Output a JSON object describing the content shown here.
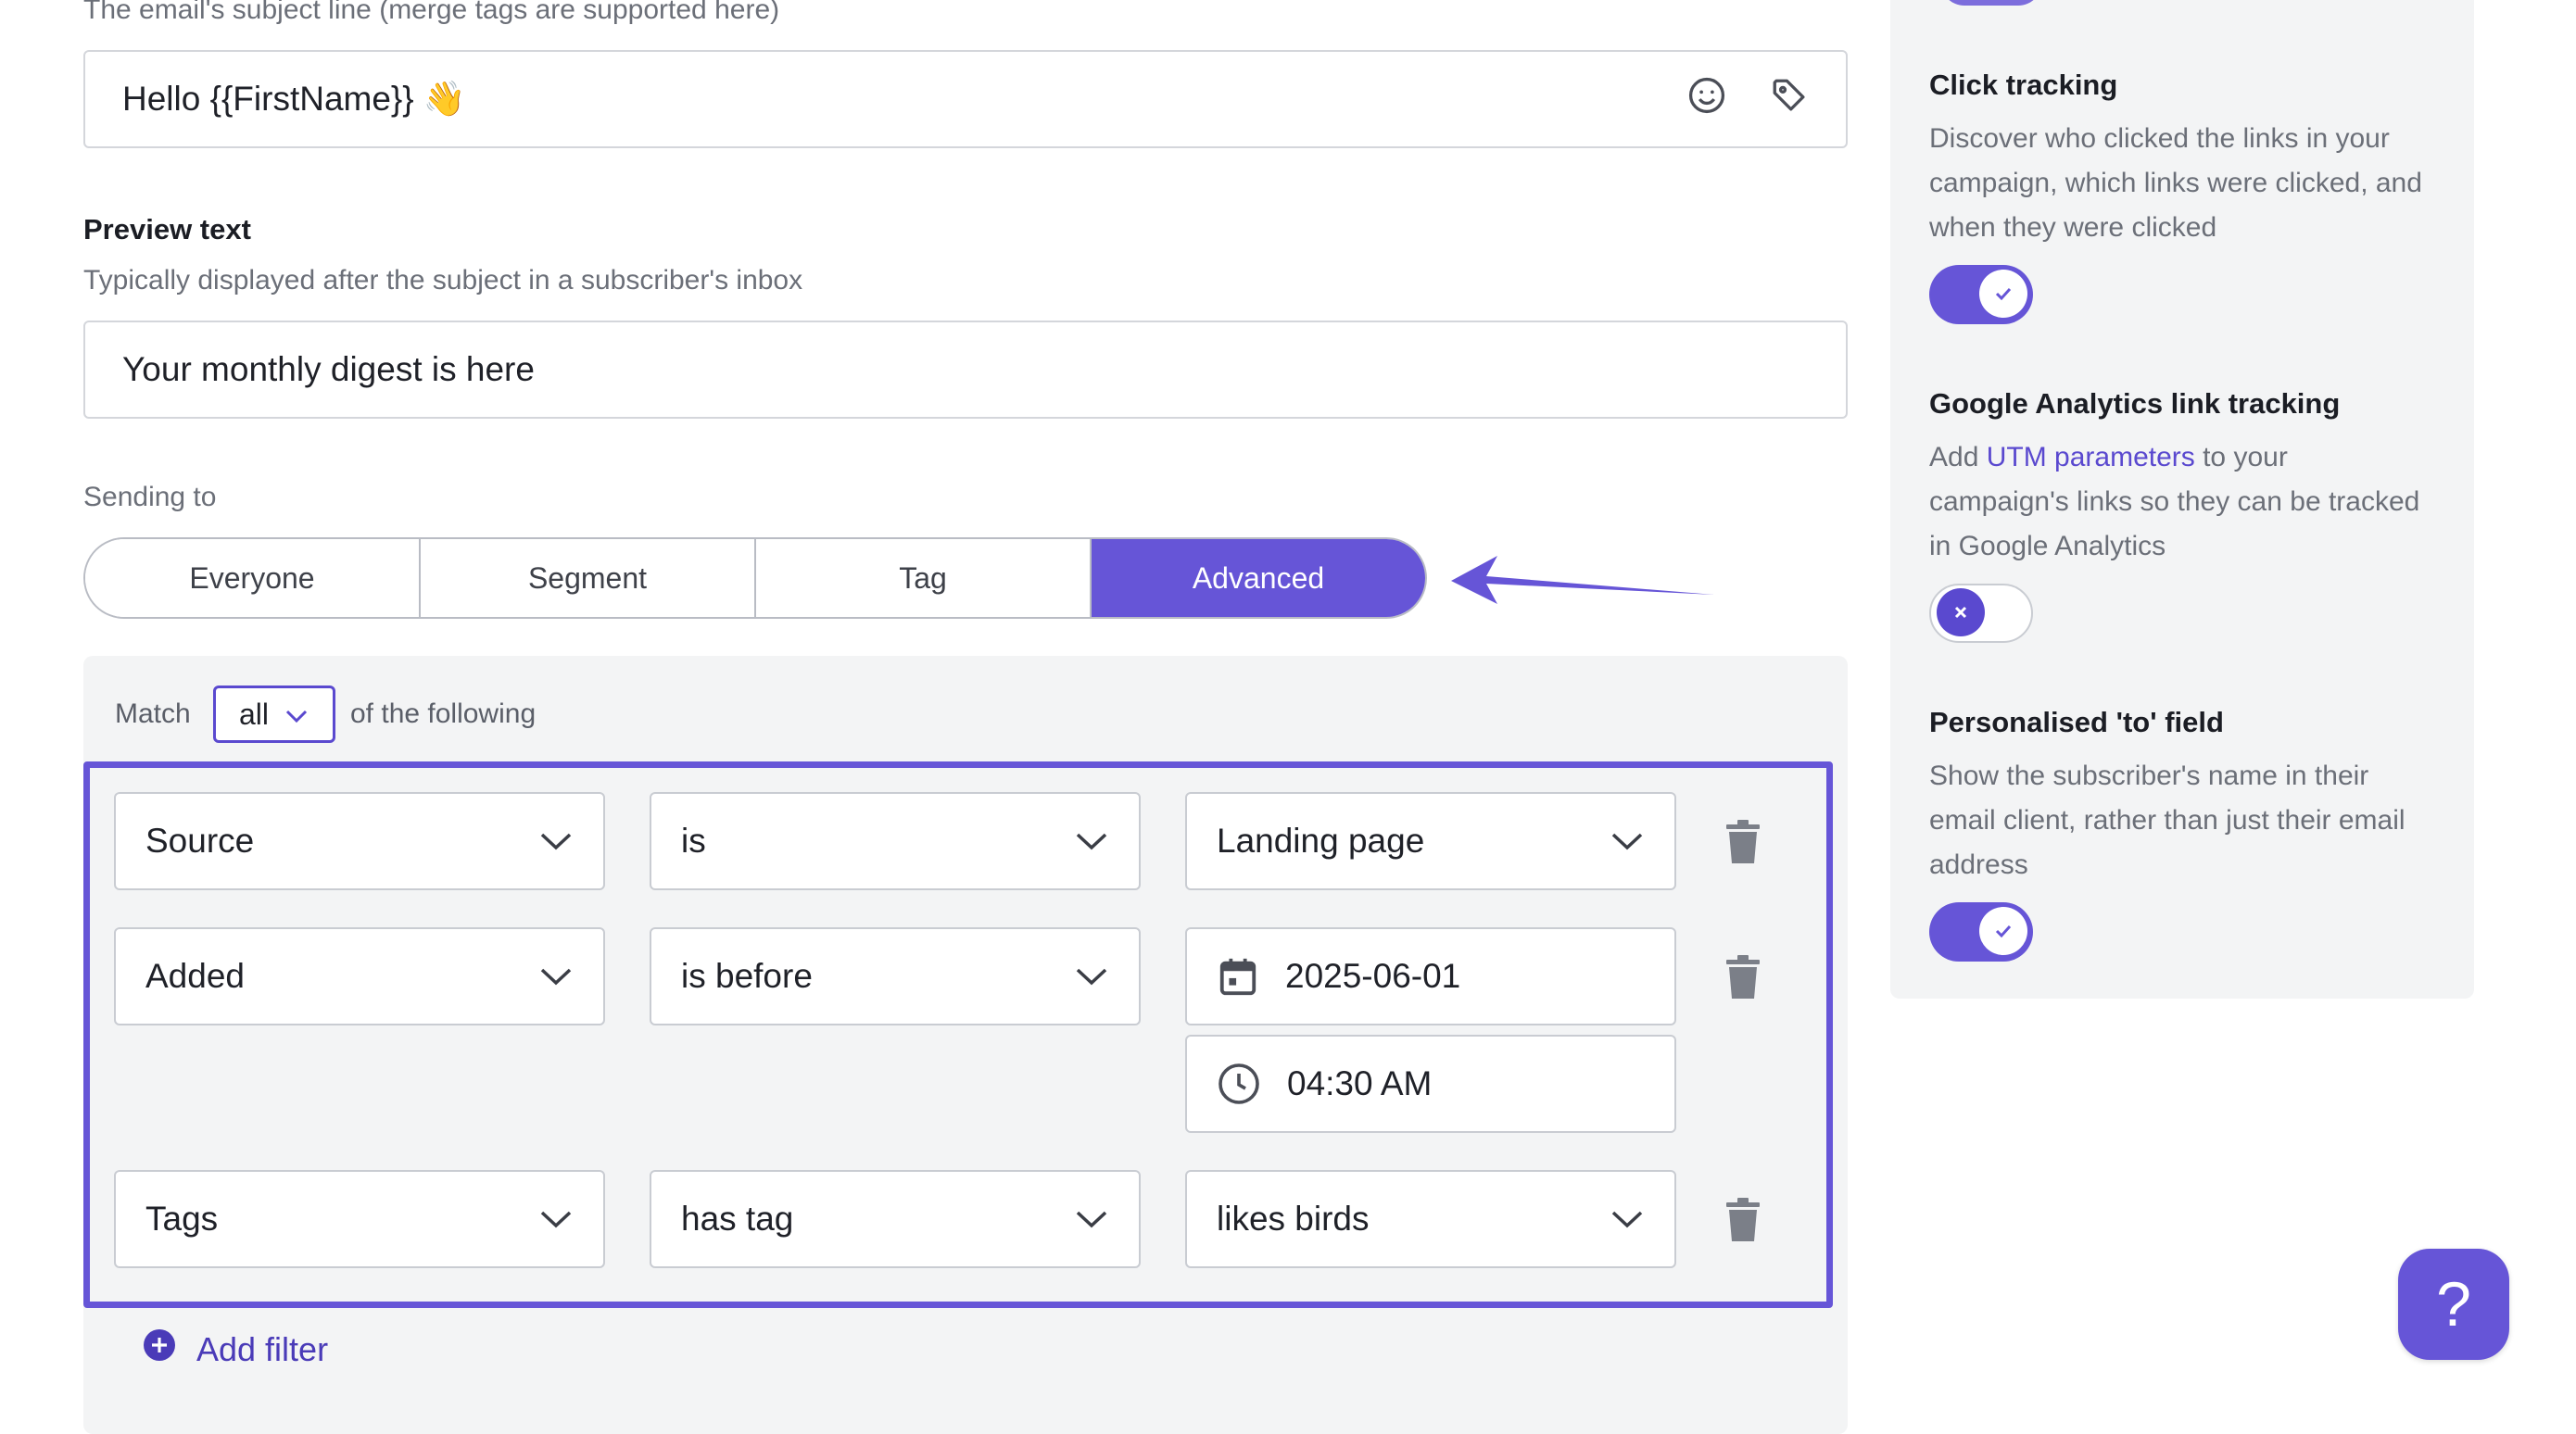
{
  "subject": {
    "hint_prefix": "The email's subject line (merge tags are supported ",
    "hint_link": "here",
    "hint_suffix": ")",
    "value": "Hello {{FirstName}} 👋",
    "emoji_icon": "smiley-icon",
    "tag_icon": "tag-icon"
  },
  "preview": {
    "label": "Preview text",
    "hint": "Typically displayed after the subject in a subscriber's inbox",
    "value": "Your monthly digest is here"
  },
  "sending": {
    "label": "Sending to",
    "options": [
      "Everyone",
      "Segment",
      "Tag",
      "Advanced"
    ],
    "active": "Advanced"
  },
  "filters": {
    "match_prefix": "Match",
    "match_value": "all",
    "match_suffix": "of the following",
    "rows": [
      {
        "field": "Source",
        "operator": "is",
        "value": "Landing page"
      },
      {
        "field": "Added",
        "operator": "is before",
        "date": "2025-06-01",
        "time": "04:30 AM"
      },
      {
        "field": "Tags",
        "operator": "has tag",
        "value": "likes birds"
      }
    ],
    "add_label": "Add filter"
  },
  "sidebar": {
    "click_tracking": {
      "title": "Click tracking",
      "desc_lines": [
        "Discover who clicked the links in your",
        "campaign, which links were clicked, and",
        "when they were clicked"
      ],
      "enabled": true
    },
    "ga_tracking": {
      "title": "Google Analytics link tracking",
      "desc_prefix": "Add ",
      "desc_link": "UTM parameters",
      "desc_rest": " to your",
      "desc_lines": [
        "campaign's links so they can be tracked",
        "in Google Analytics"
      ],
      "enabled": false
    },
    "personalised_to": {
      "title": "Personalised 'to' field",
      "desc_lines": [
        "Show the subscriber's name in their",
        "email client, rather than just their email",
        "address"
      ],
      "enabled": true
    }
  },
  "help": {
    "label": "?"
  },
  "colors": {
    "accent": "#6655d7",
    "panel": "#f3f4f5"
  }
}
